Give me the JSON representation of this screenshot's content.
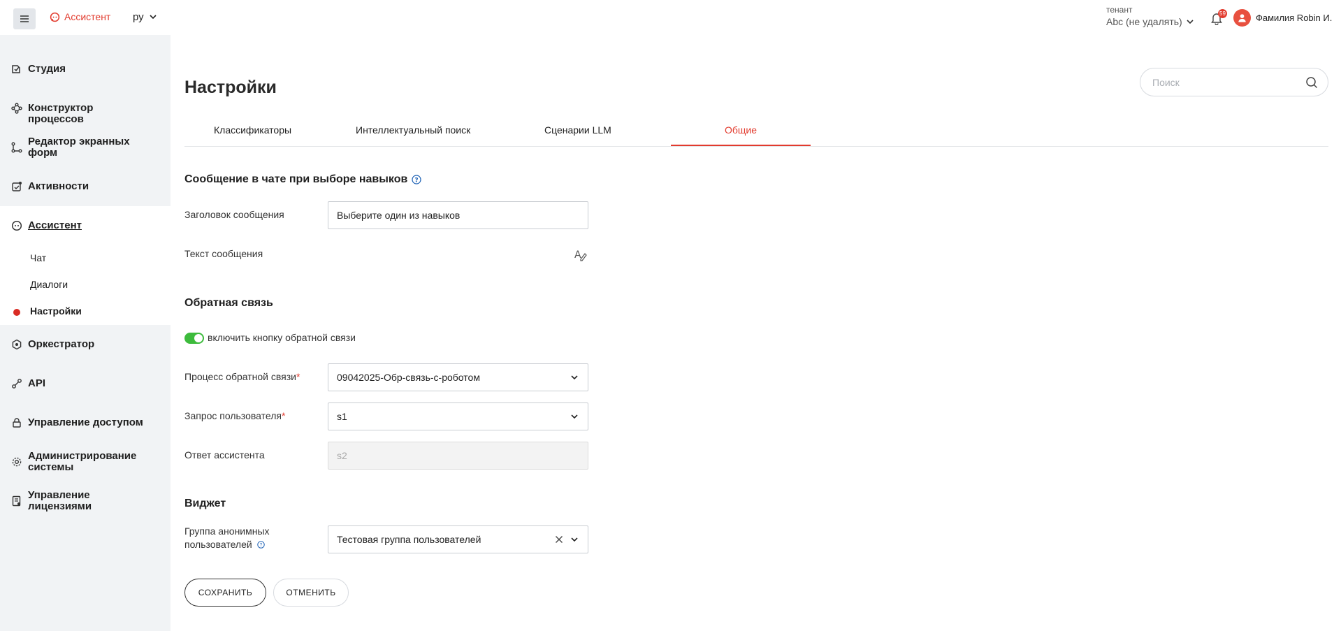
{
  "topbar": {
    "brand": "Ассистент",
    "language": "ру",
    "tenant_caption": "тенант",
    "tenant_value": "Abc (не удалять)",
    "notification_count": "59",
    "user_name": "Фамилия Robin И."
  },
  "sidebar": {
    "items": [
      {
        "label": "Студия",
        "icon": "studio-icon"
      },
      {
        "label": "Конструктор процессов",
        "icon": "process-builder-icon"
      },
      {
        "label": "Редактор экранных форм",
        "icon": "form-editor-icon"
      },
      {
        "label": "Активности",
        "icon": "activities-icon"
      },
      {
        "label": "Ассистент",
        "icon": "assistant-icon"
      },
      {
        "label": "Оркестратор",
        "icon": "orchestrator-icon"
      },
      {
        "label": "API",
        "icon": "api-icon"
      },
      {
        "label": "Управление доступом",
        "icon": "access-icon"
      },
      {
        "label": "Администрирование системы",
        "icon": "admin-icon"
      },
      {
        "label": "Управление лицензиями",
        "icon": "license-icon"
      }
    ],
    "sub_items": [
      {
        "label": "Чат"
      },
      {
        "label": "Диалоги"
      },
      {
        "label": "Настройки"
      }
    ]
  },
  "main": {
    "title": "Настройки",
    "search_placeholder": "Поиск",
    "tabs": [
      {
        "label": "Классификаторы"
      },
      {
        "label": "Интеллектуальный поиск"
      },
      {
        "label": "Сценарии LLM"
      },
      {
        "label": "Общие"
      }
    ],
    "chat_section": {
      "title": "Сообщение в чате при выборе навыков",
      "header_label": "Заголовок сообщения",
      "header_value": "Выберите один из навыков",
      "text_label": "Текст сообщения"
    },
    "feedback_section": {
      "title": "Обратная связь",
      "toggle_label": "включить кнопку обратной связи",
      "toggle_on": true,
      "process_label": "Процесс обратной связи",
      "process_value": "09042025-Обр-связь-с-роботом",
      "request_label": "Запрос пользователя",
      "request_value": "s1",
      "answer_label": "Ответ ассистента",
      "answer_value": "s2"
    },
    "widget_section": {
      "title": "Виджет",
      "group_label": "Группа анонимных пользователей",
      "group_value": "Тестовая группа пользователей"
    },
    "buttons": {
      "save": "СОХРАНИТЬ",
      "cancel": "ОТМЕНИТЬ"
    }
  },
  "colors": {
    "accent": "#e23b2e",
    "toggle": "#3dbb3c",
    "sidebar_bg": "#f1f3f5"
  }
}
